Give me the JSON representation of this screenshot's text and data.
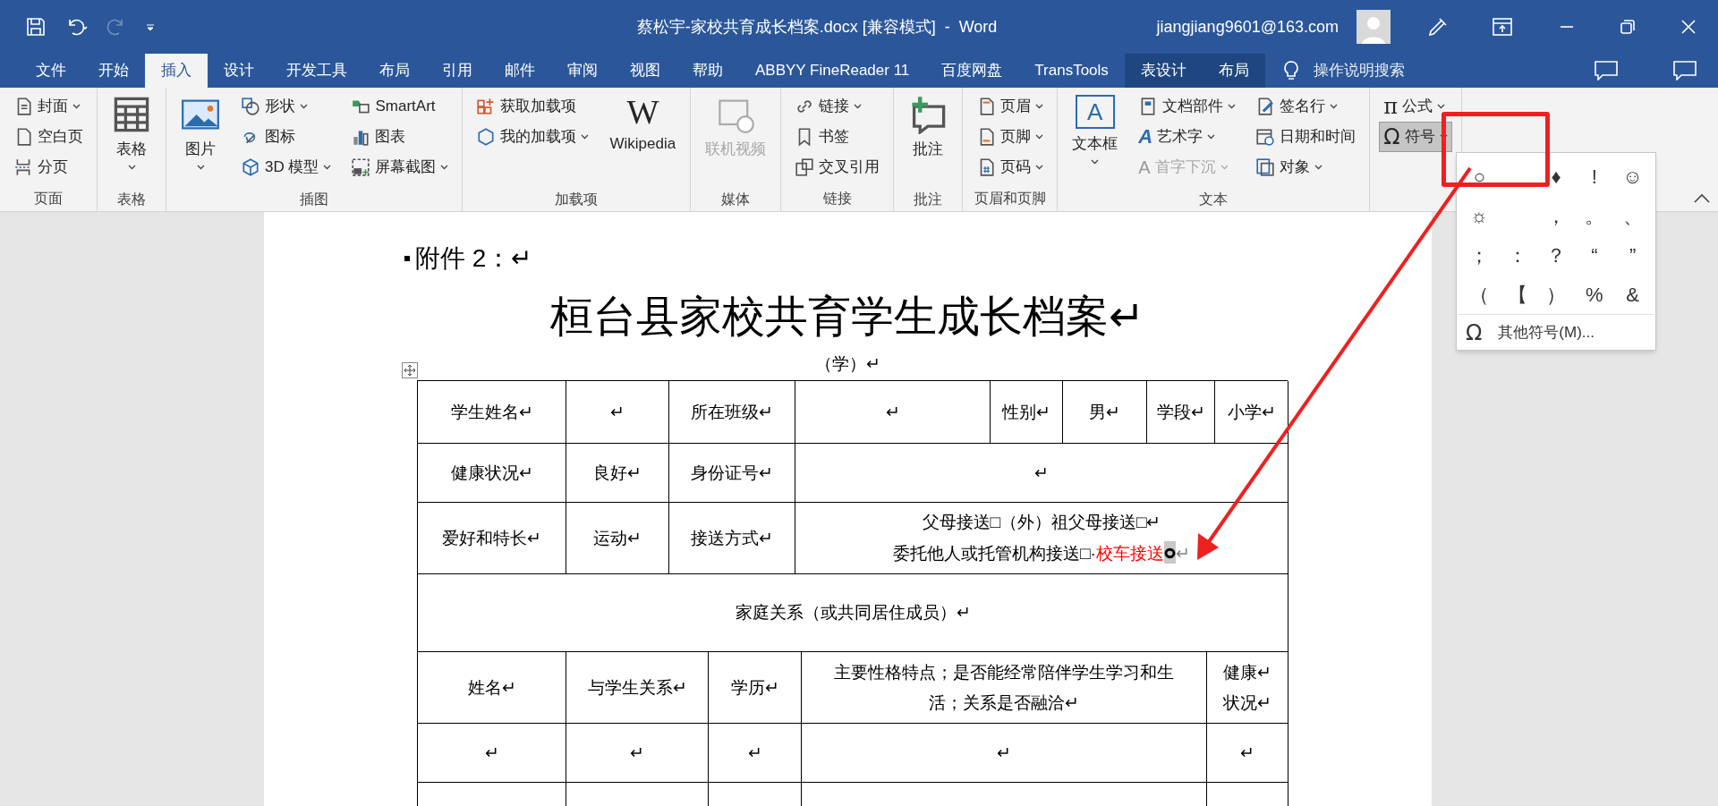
{
  "title_bar": {
    "title": "蔡松宇-家校共育成长档案.docx [兼容模式]  -  Word",
    "account": "jiangjiang9601@163.com",
    "redo_disabled": true
  },
  "tabs": [
    {
      "label": "文件",
      "selected": false,
      "contextual": false
    },
    {
      "label": "开始",
      "selected": false,
      "contextual": false
    },
    {
      "label": "插入",
      "selected": true,
      "contextual": false
    },
    {
      "label": "设计",
      "selected": false,
      "contextual": false
    },
    {
      "label": "开发工具",
      "selected": false,
      "contextual": false
    },
    {
      "label": "布局",
      "selected": false,
      "contextual": false
    },
    {
      "label": "引用",
      "selected": false,
      "contextual": false
    },
    {
      "label": "邮件",
      "selected": false,
      "contextual": false
    },
    {
      "label": "审阅",
      "selected": false,
      "contextual": false
    },
    {
      "label": "视图",
      "selected": false,
      "contextual": false
    },
    {
      "label": "帮助",
      "selected": false,
      "contextual": false
    },
    {
      "label": "ABBYY FineReader 11",
      "selected": false,
      "contextual": false
    },
    {
      "label": "百度网盘",
      "selected": false,
      "contextual": false
    },
    {
      "label": "TransTools",
      "selected": false,
      "contextual": false
    },
    {
      "label": "表设计",
      "selected": false,
      "contextual": true
    },
    {
      "label": "布局",
      "selected": false,
      "contextual": true
    }
  ],
  "search": {
    "placeholder": "操作说明搜索"
  },
  "ribbon": {
    "groups": [
      {
        "label": "页面",
        "columns": [
          [
            {
              "label": "封面",
              "kind": "small",
              "dropdown": true,
              "disabled": false
            },
            {
              "label": "空白页",
              "kind": "small",
              "dropdown": false,
              "disabled": false
            },
            {
              "label": "分页",
              "kind": "small",
              "dropdown": false,
              "disabled": false
            }
          ]
        ]
      },
      {
        "label": "表格",
        "columns": [
          [
            {
              "label": "表格",
              "kind": "large",
              "dropdown": true,
              "disabled": false
            }
          ]
        ]
      },
      {
        "label": "插图",
        "columns": [
          [
            {
              "label": "图片",
              "kind": "large",
              "dropdown": true,
              "disabled": false
            }
          ],
          [
            {
              "label": "形状",
              "kind": "small",
              "dropdown": true,
              "disabled": false
            },
            {
              "label": "图标",
              "kind": "small",
              "dropdown": false,
              "disabled": false
            },
            {
              "label": "3D 模型",
              "kind": "small",
              "dropdown": true,
              "disabled": false
            }
          ],
          [
            {
              "label": "SmartArt",
              "kind": "small",
              "dropdown": false,
              "disabled": false
            },
            {
              "label": "图表",
              "kind": "small",
              "dropdown": false,
              "disabled": false
            },
            {
              "label": "屏幕截图",
              "kind": "small",
              "dropdown": true,
              "disabled": false
            }
          ]
        ]
      },
      {
        "label": "加载项",
        "columns": [
          [
            {
              "label": "获取加载项",
              "kind": "small",
              "dropdown": false,
              "disabled": false
            },
            {
              "label": "我的加载项",
              "kind": "small",
              "dropdown": true,
              "disabled": false
            }
          ],
          [
            {
              "label": "Wikipedia",
              "kind": "large",
              "dropdown": false,
              "disabled": false,
              "glyph": "W"
            }
          ]
        ]
      },
      {
        "label": "媒体",
        "columns": [
          [
            {
              "label": "联机视频",
              "kind": "large",
              "dropdown": false,
              "disabled": true
            }
          ]
        ]
      },
      {
        "label": "链接",
        "columns": [
          [
            {
              "label": "链接",
              "kind": "small",
              "dropdown": true,
              "disabled": false
            },
            {
              "label": "书签",
              "kind": "small",
              "dropdown": false,
              "disabled": false
            },
            {
              "label": "交叉引用",
              "kind": "small",
              "dropdown": false,
              "disabled": false
            }
          ]
        ]
      },
      {
        "label": "批注",
        "columns": [
          [
            {
              "label": "批注",
              "kind": "large",
              "dropdown": false,
              "disabled": false
            }
          ]
        ]
      },
      {
        "label": "页眉和页脚",
        "columns": [
          [
            {
              "label": "页眉",
              "kind": "small",
              "dropdown": true,
              "disabled": false
            },
            {
              "label": "页脚",
              "kind": "small",
              "dropdown": true,
              "disabled": false
            },
            {
              "label": "页码",
              "kind": "small",
              "dropdown": true,
              "disabled": false
            }
          ]
        ]
      },
      {
        "label": "文本",
        "columns": [
          [
            {
              "label": "文本框",
              "kind": "large",
              "dropdown": true,
              "disabled": false,
              "glyph": "A"
            }
          ],
          [
            {
              "label": "文档部件",
              "kind": "small",
              "dropdown": true,
              "disabled": false
            },
            {
              "label": "艺术字",
              "kind": "small",
              "dropdown": true,
              "disabled": false,
              "glyph": "A"
            },
            {
              "label": "首字下沉",
              "kind": "small",
              "dropdown": true,
              "disabled": true,
              "glyph": "A"
            }
          ],
          [
            {
              "label": "签名行",
              "kind": "small",
              "dropdown": true,
              "disabled": false
            },
            {
              "label": "日期和时间",
              "kind": "small",
              "dropdown": false,
              "disabled": false
            },
            {
              "label": "对象",
              "kind": "small",
              "dropdown": true,
              "disabled": false
            }
          ]
        ]
      },
      {
        "columns": [
          [
            {
              "label": "公式",
              "kind": "small",
              "dropdown": true,
              "disabled": false,
              "glyph": "π",
              "pressed": false
            },
            {
              "label": "符号",
              "kind": "small",
              "dropdown": true,
              "disabled": false,
              "glyph": "Ω",
              "pressed": true
            }
          ]
        ]
      }
    ]
  },
  "symbol_menu": {
    "rows": [
      [
        {
          "symbol": "○"
        },
        {},
        {
          "symbol": "♦"
        },
        {
          "symbol": "!"
        },
        {
          "symbol": "☺"
        }
      ],
      [
        {
          "symbol": "☼"
        },
        {},
        {
          "symbol": "，"
        },
        {
          "symbol": "。"
        },
        {
          "symbol": "、"
        }
      ],
      [
        {
          "symbol": "；"
        },
        {
          "symbol": "："
        },
        {
          "symbol": "？"
        },
        {
          "symbol": "“"
        },
        {
          "symbol": "”"
        }
      ],
      [
        {
          "symbol": "（"
        },
        {
          "symbol": "【"
        },
        {
          "symbol": "）"
        },
        {
          "symbol": "%"
        },
        {
          "symbol": "&"
        }
      ]
    ],
    "more_glyph": "Ω",
    "more": "其他符号(M)..."
  },
  "document": {
    "attachment": "附件 2：↵",
    "title": "桓台县家校共育学生成长档案↵",
    "subtitle": "（学）↵",
    "table_1": {
      "rows": [
        {
          "cells": [
            {
              "lines": [
                "学生姓名↵"
              ]
            },
            {
              "lines": [
                "↵"
              ]
            },
            {
              "lines": [
                "所在班级↵"
              ]
            },
            {
              "lines": [
                "↵"
              ]
            },
            {
              "lines": [
                "性别↵"
              ]
            },
            {
              "lines": [
                "男↵"
              ]
            },
            {
              "lines": [
                "学段↵"
              ]
            },
            {
              "lines": [
                "小学↵"
              ]
            }
          ]
        },
        {
          "cells": [
            {
              "lines": [
                "健康状况↵"
              ]
            },
            {
              "lines": [
                "良好↵"
              ]
            },
            {
              "lines": [
                "身份证号↵"
              ]
            },
            {
              "lines": [
                "↵"
              ]
            }
          ]
        },
        {
          "cells": [
            {
              "lines": [
                "爱好和特长↵"
              ]
            },
            {
              "lines": [
                "运动↵"
              ]
            },
            {
              "lines": [
                "接送方式↵"
              ]
            },
            {
              "lines": [
                "父母接送□（外）祖父母接送□↵",
                {
                  "segments": [
                    {
                      "text": "委托他人或托管机构接送□·",
                      "color": "#000000",
                      "selected": false
                    },
                    {
                      "text": "校车接送",
                      "color": "#ff0000",
                      "selected": false
                    },
                    {
                      "text": "○",
                      "color": "#000000",
                      "selected": true
                    },
                    {
                      "text": "↵",
                      "color": "#808080",
                      "selected": false
                    }
                  ]
                }
              ]
            }
          ]
        },
        {
          "cells": [
            {
              "lines": [
                "家庭关系（或共同居住成员）↵"
              ]
            }
          ]
        }
      ]
    },
    "table_2": {
      "rows": [
        {
          "cells": [
            {
              "lines": [
                "姓名↵"
              ]
            },
            {
              "lines": [
                "与学生关系↵"
              ]
            },
            {
              "lines": [
                "学历↵"
              ]
            },
            {
              "lines": [
                "主要性格特点；是否能经常陪伴学生学习和生活；关系是否融洽↵"
              ]
            },
            {
              "lines": [
                "健康↵",
                "状况↵"
              ]
            }
          ]
        },
        {
          "cells": [
            {
              "lines": [
                "↵"
              ]
            },
            {
              "lines": [
                "↵"
              ]
            },
            {
              "lines": [
                "↵"
              ]
            },
            {
              "lines": [
                "↵"
              ]
            },
            {
              "lines": [
                "↵"
              ]
            }
          ]
        }
      ]
    }
  }
}
